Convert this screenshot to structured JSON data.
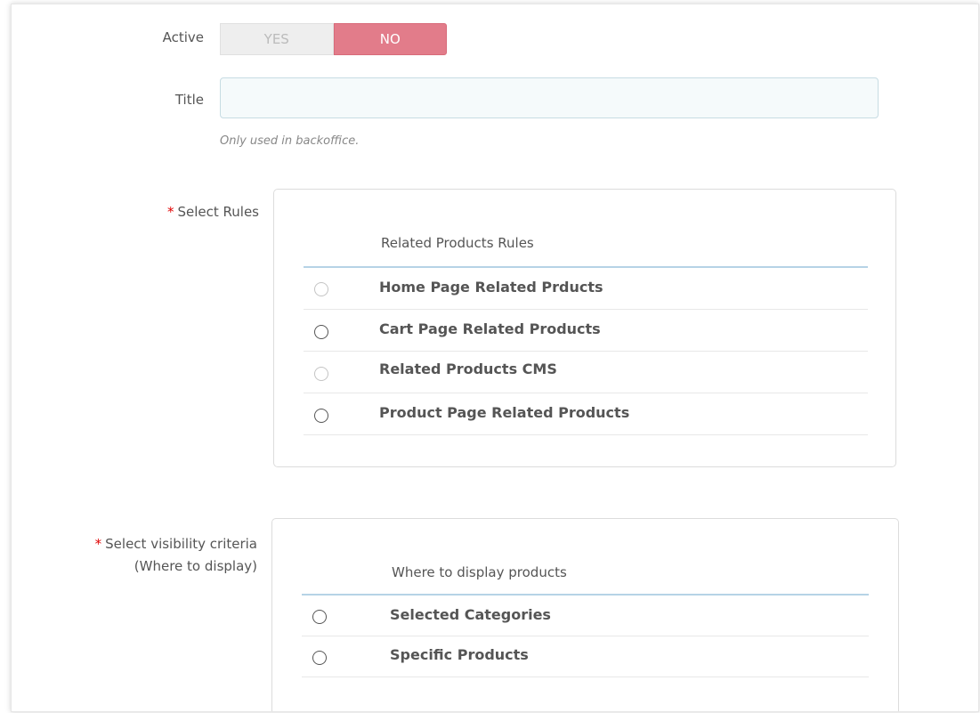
{
  "form": {
    "active": {
      "label": "Active",
      "yes_label": "YES",
      "no_label": "NO",
      "value": "NO"
    },
    "title": {
      "label": "Title",
      "value": "",
      "placeholder": "",
      "help": "Only used in backoffice."
    },
    "rules": {
      "required_marker": "*",
      "label": "Select Rules",
      "header": "Related Products Rules",
      "options": [
        {
          "label": "Home Page Related Prducts",
          "checked": false
        },
        {
          "label": "Cart Page Related Products",
          "checked": false
        },
        {
          "label": "Related Products CMS",
          "checked": false
        },
        {
          "label": "Product Page Related Products",
          "checked": false
        }
      ]
    },
    "visibility": {
      "required_marker": "*",
      "label_line1": "Select visibility criteria",
      "label_line2": "(Where to display)",
      "header": "Where to display products",
      "options": [
        {
          "label": "Selected Categories",
          "checked": false
        },
        {
          "label": "Specific Products",
          "checked": false
        }
      ]
    }
  },
  "colors": {
    "no_active": "#e27c8a",
    "required": "#e00000",
    "header_underline": "#b6d3e6"
  }
}
